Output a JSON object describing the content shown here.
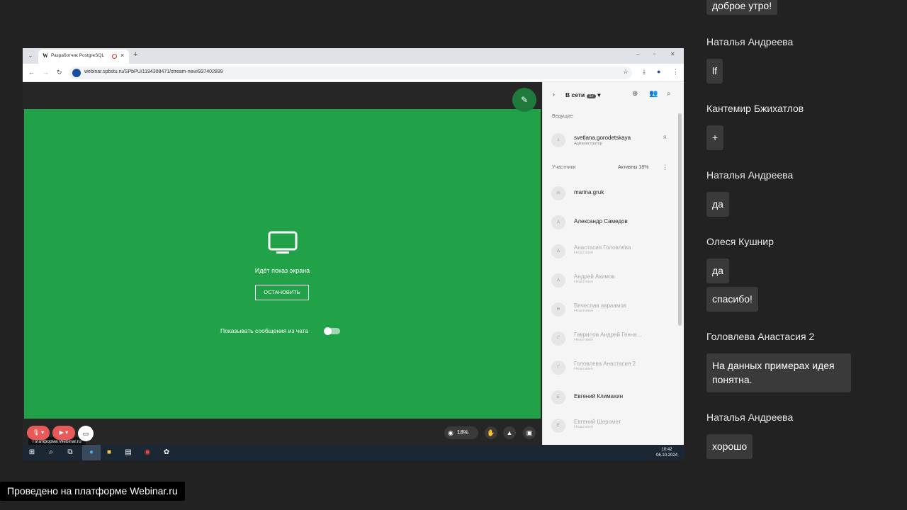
{
  "browser": {
    "tab_title": "Разработчик PostgreSQL",
    "tab_favicon": "W",
    "url": "webinar.spbstu.ru/SPbPU/1194308471/stream-new/937402899"
  },
  "stream": {
    "sharing_text": "Идёт показ экрана",
    "stop_label": "ОСТАНОВИТЬ",
    "show_chat_label": "Показывать сообщения из чата",
    "platform_tooltip": "Платформа Webinar.ru",
    "views_percent": "18%"
  },
  "sidebar": {
    "online_label": "В сети",
    "online_count": "17",
    "hosts_title": "Ведущие",
    "participants_title": "Участники",
    "active_label": "Активны 18%",
    "host": {
      "initial": "s",
      "name": "svetlana.gorodetskaya",
      "role": "Администратор",
      "tag": "Я"
    },
    "participants": [
      {
        "initial": "m",
        "name": "marina.gruk",
        "sub": ""
      },
      {
        "initial": "А",
        "name": "Александр Самедов",
        "sub": ""
      },
      {
        "initial": "А",
        "name": "Анастасия Головлева",
        "sub": "Неактивен"
      },
      {
        "initial": "А",
        "name": "Андрей Акимов",
        "sub": "Неактивен"
      },
      {
        "initial": "В",
        "name": "Вячеслав авраамов",
        "sub": "Неактивен"
      },
      {
        "initial": "Г",
        "name": "Гаврилов Андрей Генна...",
        "sub": "Неактивен"
      },
      {
        "initial": "Г",
        "name": "Головлева Анастасия 2",
        "sub": "Неактивен"
      },
      {
        "initial": "Е",
        "name": "Евгений Климахин",
        "sub": ""
      },
      {
        "initial": "Е",
        "name": "Евгений Шеромет",
        "sub": "Неактивен"
      }
    ]
  },
  "taskbar": {
    "time": "10:42",
    "date": "06.10.2024"
  },
  "chat": {
    "messages": [
      {
        "author": "",
        "text": "доброе утро!"
      },
      {
        "author": "Наталья Андреева",
        "text": "lf"
      },
      {
        "author": "Кантемир Бжихатлов",
        "text": "+"
      },
      {
        "author": "Наталья Андреева",
        "text": "да"
      },
      {
        "author": "Олеся Кушнир",
        "text": "да"
      },
      {
        "author": "",
        "text": "спасибо!"
      },
      {
        "author": "Головлева Анастасия 2",
        "text": "На данных примерах идея понятна."
      },
      {
        "author": "Наталья Андреева",
        "text": "хорошо"
      }
    ]
  },
  "footer": {
    "text": "Проведено на платформе Webinar.ru"
  },
  "colors": {
    "stream_green": "#21a249",
    "background": "#222222",
    "bubble": "#3a3a3a",
    "mic_red": "#e85a5a"
  }
}
